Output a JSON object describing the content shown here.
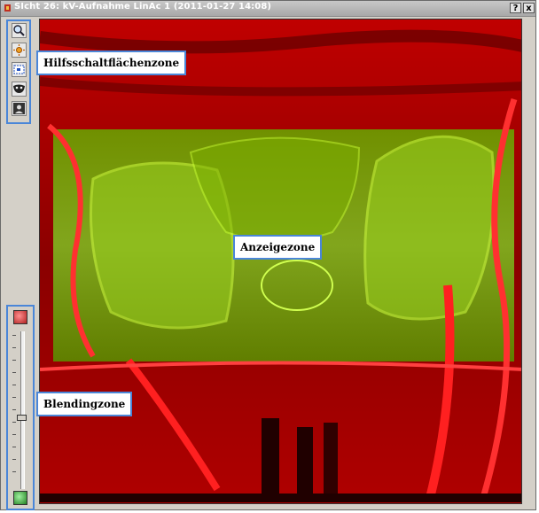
{
  "window": {
    "title": "SIcht 26: kV-Aufnahme LinAc 1 (2011-01-27 14:08)",
    "help_label": "?",
    "close_label": "x"
  },
  "toolbar": {
    "tools": [
      "zoom-icon",
      "sun-icon",
      "select-icon",
      "mask-icon",
      "portrait-icon"
    ]
  },
  "blending": {
    "top_color": "#c04040",
    "bottom_color": "#40a040",
    "level": 0.55
  },
  "callouts": {
    "toolbar_label": "Hilfsschaltflächenzone",
    "display_label": "Anzeigezone",
    "blend_label": "Blendingzone"
  },
  "colors": {
    "accent": "#4a86d8",
    "image_red": "#c80000",
    "image_green": "#78c000"
  }
}
